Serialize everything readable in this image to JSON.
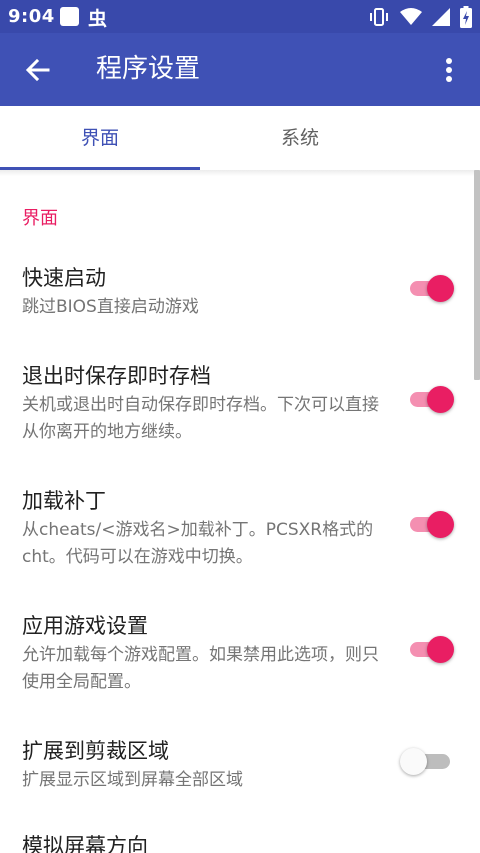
{
  "status_bar": {
    "time": "9:04",
    "notification_icons": [
      "square-app-icon",
      "bug-icon"
    ],
    "bug_glyph": "虫",
    "system_icons": [
      "vibrate-icon",
      "wifi-icon",
      "signal-icon",
      "battery-charging-icon"
    ]
  },
  "app_bar": {
    "title": "程序设置",
    "color": "#3f51b5"
  },
  "tabs": [
    {
      "label": "界面",
      "selected": true
    },
    {
      "label": "系统",
      "selected": false
    }
  ],
  "section": {
    "header": "界面",
    "accent_color": "#e91e63"
  },
  "preferences": [
    {
      "title": "快速启动",
      "summary": "跳过BIOS直接启动游戏",
      "enabled": true
    },
    {
      "title": "退出时保存即时存档",
      "summary": "关机或退出时自动保存即时存档。下次可以直接从你离开的地方继续。",
      "enabled": true
    },
    {
      "title": "加载补丁",
      "summary": "从cheats/<游戏名>加载补丁。PCSXR格式的cht。代码可以在游戏中切换。",
      "enabled": true
    },
    {
      "title": "应用游戏设置",
      "summary": "允许加载每个游戏配置。如果禁用此选项，则只使用全局配置。",
      "enabled": true
    },
    {
      "title": "扩展到剪裁区域",
      "summary": "扩展显示区域到屏幕全部区域",
      "enabled": false
    },
    {
      "title": "模拟屏幕方向",
      "summary": "",
      "enabled": null
    }
  ]
}
